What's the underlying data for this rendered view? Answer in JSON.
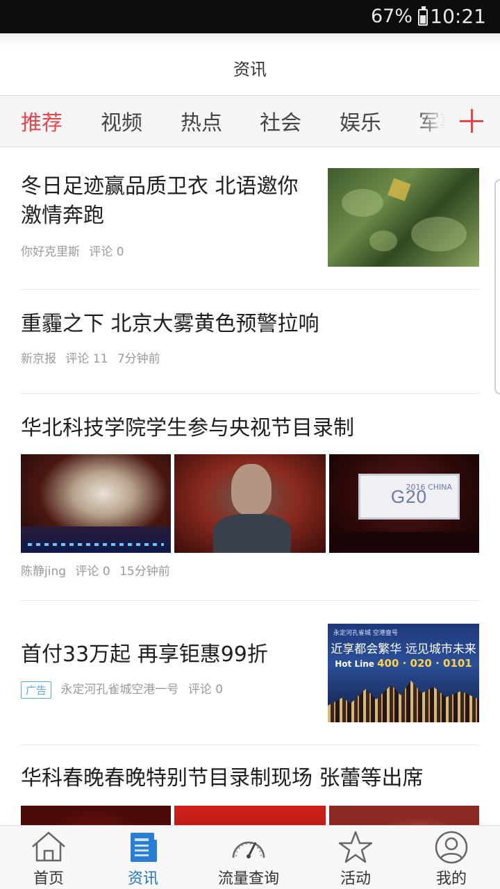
{
  "status_bar": {
    "battery": "67%",
    "time": "10:21"
  },
  "header": {
    "title": "资讯"
  },
  "tabs": [
    {
      "label": "推荐",
      "active": true
    },
    {
      "label": "视频",
      "active": false
    },
    {
      "label": "热点",
      "active": false
    },
    {
      "label": "社会",
      "active": false
    },
    {
      "label": "娱乐",
      "active": false
    },
    {
      "label": "军事",
      "active": false
    }
  ],
  "feed": [
    {
      "title": "冬日足迹赢品质卫衣 北语邀你激情奔跑",
      "source": "你好克里斯",
      "comments": "评论 0",
      "time": ""
    },
    {
      "title": "重霾之下 北京大雾黄色预警拉响",
      "source": "新京报",
      "comments": "评论 11",
      "time": "7分钟前"
    },
    {
      "title": "华北科技学院学生参与央视节目录制",
      "source": "陈静jing",
      "comments": "评论 0",
      "time": "15分钟前"
    },
    {
      "title": "首付33万起 再享钜惠99折",
      "badge": "广告",
      "source": "永定河孔雀城空港一号",
      "comments": "评论 0",
      "time": ""
    },
    {
      "title": "华科春晚春晚特别节目录制现场 张蕾等出席"
    }
  ],
  "images": {
    "g20_text": "G20",
    "g20_year": "2016",
    "g20_country": "CHINA",
    "ad_logo": "永定河孔雀城 空港壹号",
    "ad_slogan": "近享都会繁华 远见城市未来",
    "ad_hotline_label": "Hot Line",
    "ad_hotline_number": "400 · 020 · 0101"
  },
  "bottom_nav": [
    {
      "label": "首页",
      "icon": "home-icon",
      "active": false
    },
    {
      "label": "资讯",
      "icon": "news-icon",
      "active": true
    },
    {
      "label": "流量查询",
      "icon": "gauge-icon",
      "active": false
    },
    {
      "label": "活动",
      "icon": "star-icon",
      "active": false
    },
    {
      "label": "我的",
      "icon": "user-icon",
      "active": false
    }
  ],
  "colors": {
    "accent_red": "#e8454a",
    "accent_blue": "#1f74c9",
    "ad_badge": "#57a8de"
  }
}
